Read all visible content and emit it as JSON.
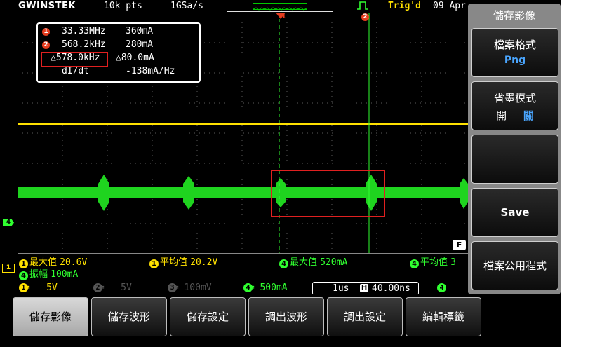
{
  "topbar": {
    "brand": "GWINSTEK",
    "record_length": "10k pts",
    "sample_rate": "1GSa/s",
    "trigger_status": "Trig'd",
    "date": "09 Apr"
  },
  "cursor_readout": {
    "row1": {
      "marker": "1",
      "freq": "33.33MHz",
      "value": "360mA"
    },
    "row2": {
      "marker": "2",
      "freq": "568.2kHz",
      "value": "280mA"
    },
    "row3": {
      "freq": "△578.0kHz",
      "value": "△80.0mA"
    },
    "row4": {
      "label": "dI/dt",
      "value": "-138mA/Hz"
    }
  },
  "cursor_markers": {
    "c1": "1",
    "c2": "2"
  },
  "level_markers": {
    "ch4": "4",
    "trig": "F"
  },
  "measurements": {
    "m1": {
      "ch": "1",
      "name": "最大值",
      "value": "20.6V"
    },
    "m2": {
      "ch": "1",
      "name": "平均值",
      "value": "20.2V"
    },
    "m3": {
      "ch": "4",
      "name": "最大值",
      "value": "520mA"
    },
    "m4": {
      "ch": "4",
      "name": "平均值",
      "value": "3"
    },
    "m5": {
      "ch": "4",
      "name": "振幅",
      "value": "100mA"
    },
    "row_marker": "1"
  },
  "channel_bar": {
    "ch1": {
      "num": "1",
      "coupling": "==",
      "scale": "5V"
    },
    "ch2": {
      "num": "2",
      "coupling": "==",
      "scale": "5V"
    },
    "ch3": {
      "num": "3",
      "coupling": "==",
      "scale": "100mV"
    },
    "ch4": {
      "num": "4",
      "coupling": "==",
      "scale": "500mA"
    },
    "timebase": "1us",
    "h_pos_icon": "H",
    "h_position": "40.00ns",
    "trig_source": "4"
  },
  "side_menu": {
    "title": "儲存影像",
    "format_label": "檔案格式",
    "format_value": "Png",
    "ink_label": "省墨模式",
    "ink_on": "開",
    "ink_off": "關",
    "save": "Save",
    "utility": "檔案公用程式"
  },
  "bottom_menu": [
    "儲存影像",
    "儲存波形",
    "儲存設定",
    "調出波形",
    "調出設定",
    "編輯標籤"
  ],
  "colors": {
    "ch1": "#ffe100",
    "ch4": "#30ff30",
    "highlight": "#e02020",
    "accent": "#4aa6ff"
  }
}
